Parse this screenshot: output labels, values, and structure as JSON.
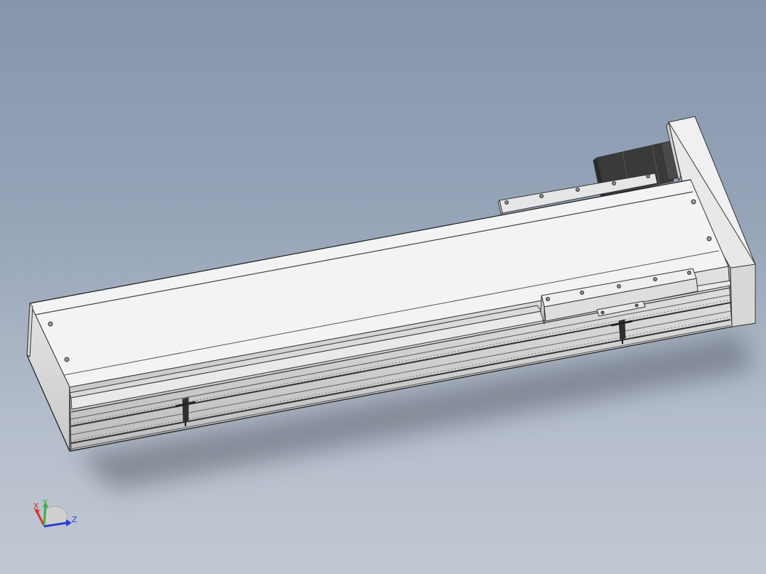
{
  "viewport": {
    "background_top": "#8596ad",
    "background_bottom": "#c2c8d3"
  },
  "model": {
    "body_color": "#f2f2f2",
    "edge_color": "#333333",
    "motor_color": "#3a3a3a"
  },
  "triad": {
    "x_label": "X",
    "y_label": "Y",
    "z_label": "Z",
    "x_color": "#e0302a",
    "y_color": "#3cb043",
    "z_color": "#2a3fcf"
  }
}
